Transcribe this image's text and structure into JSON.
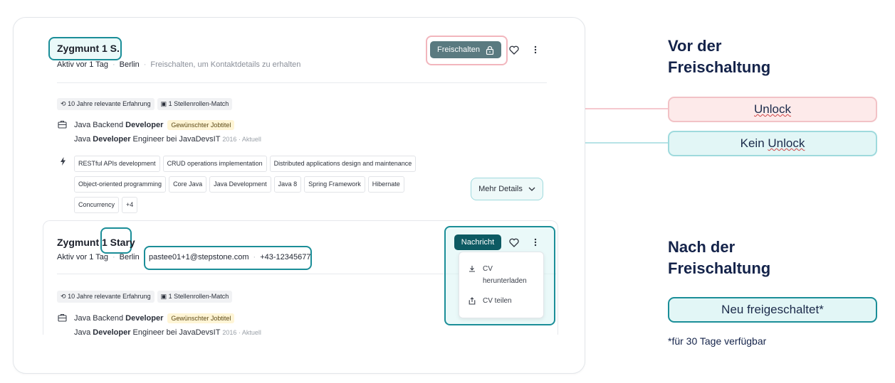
{
  "card_before": {
    "name": "Zygmunt 1 S.",
    "status": "Aktiv vor 1 Tag",
    "city": "Berlin",
    "hint": "Freischalten, um Kontaktdetails zu erhalten",
    "unlock_button": "Freischalten",
    "chips": [
      "10 Jahre relevante Erfahrung",
      "1 Stellenrollen-Match"
    ],
    "job1_prefix": "Java Backend ",
    "job1_bold": "Developer",
    "job1_badge": "Gewünschter Jobtitel",
    "job2_prefix": "Java ",
    "job2_bold": "Developer",
    "job2_suffix": " Engineer bei JavaDevsIT",
    "job2_meta": "2016 · Aktuell",
    "skills": [
      "RESTful APIs development",
      "CRUD operations implementation",
      "Distributed applications design and maintenance",
      "Object-oriented programming",
      "Core Java",
      "Java Development",
      "Java 8",
      "Spring Framework",
      "Hibernate",
      "Concurrency",
      "+4"
    ],
    "more_details": "Mehr Details"
  },
  "card_after": {
    "name_first": "Zygmunt 1 ",
    "name_last": "Stary",
    "status": "Aktiv vor 1 Tag",
    "city": "Berlin",
    "email": "pastee01+1@stepstone.com",
    "phone": "+43-12345677",
    "message_button": "Nachricht",
    "menu_download": "CV herunterladen",
    "menu_share": "CV teilen",
    "chips": [
      "10 Jahre relevante Erfahrung",
      "1 Stellenrollen-Match"
    ],
    "job1_prefix": "Java Backend ",
    "job1_bold": "Developer",
    "job1_badge": "Gewünschter Jobtitel",
    "job2_prefix": "Java ",
    "job2_bold": "Developer",
    "job2_suffix": " Engineer bei JavaDevsIT",
    "job2_meta": "2016 · Aktuell"
  },
  "annotations": {
    "before_heading_1": "Vor der",
    "before_heading_2": "Freischaltung",
    "unlock_label": "Unlock",
    "no_unlock_label_1": "Kein ",
    "no_unlock_label_2": "Unlock",
    "after_heading_1": "Nach der",
    "after_heading_2": "Freischaltung",
    "new_unlocked_label": "Neu freigeschaltet*",
    "footnote": "*für 30 Tage verfügbar"
  },
  "colors": {
    "teal_accent": "#1b8e98",
    "pink_accent": "#f2b6bd",
    "heading_navy": "#14234a",
    "button_slate": "#5a7a80",
    "button_teal": "#0d5a63"
  },
  "icons": [
    "lock-icon",
    "heart-icon",
    "more-vertical-icon",
    "history-icon",
    "briefcase-icon",
    "bolt-icon",
    "chevron-down-icon",
    "download-icon",
    "share-icon"
  ]
}
